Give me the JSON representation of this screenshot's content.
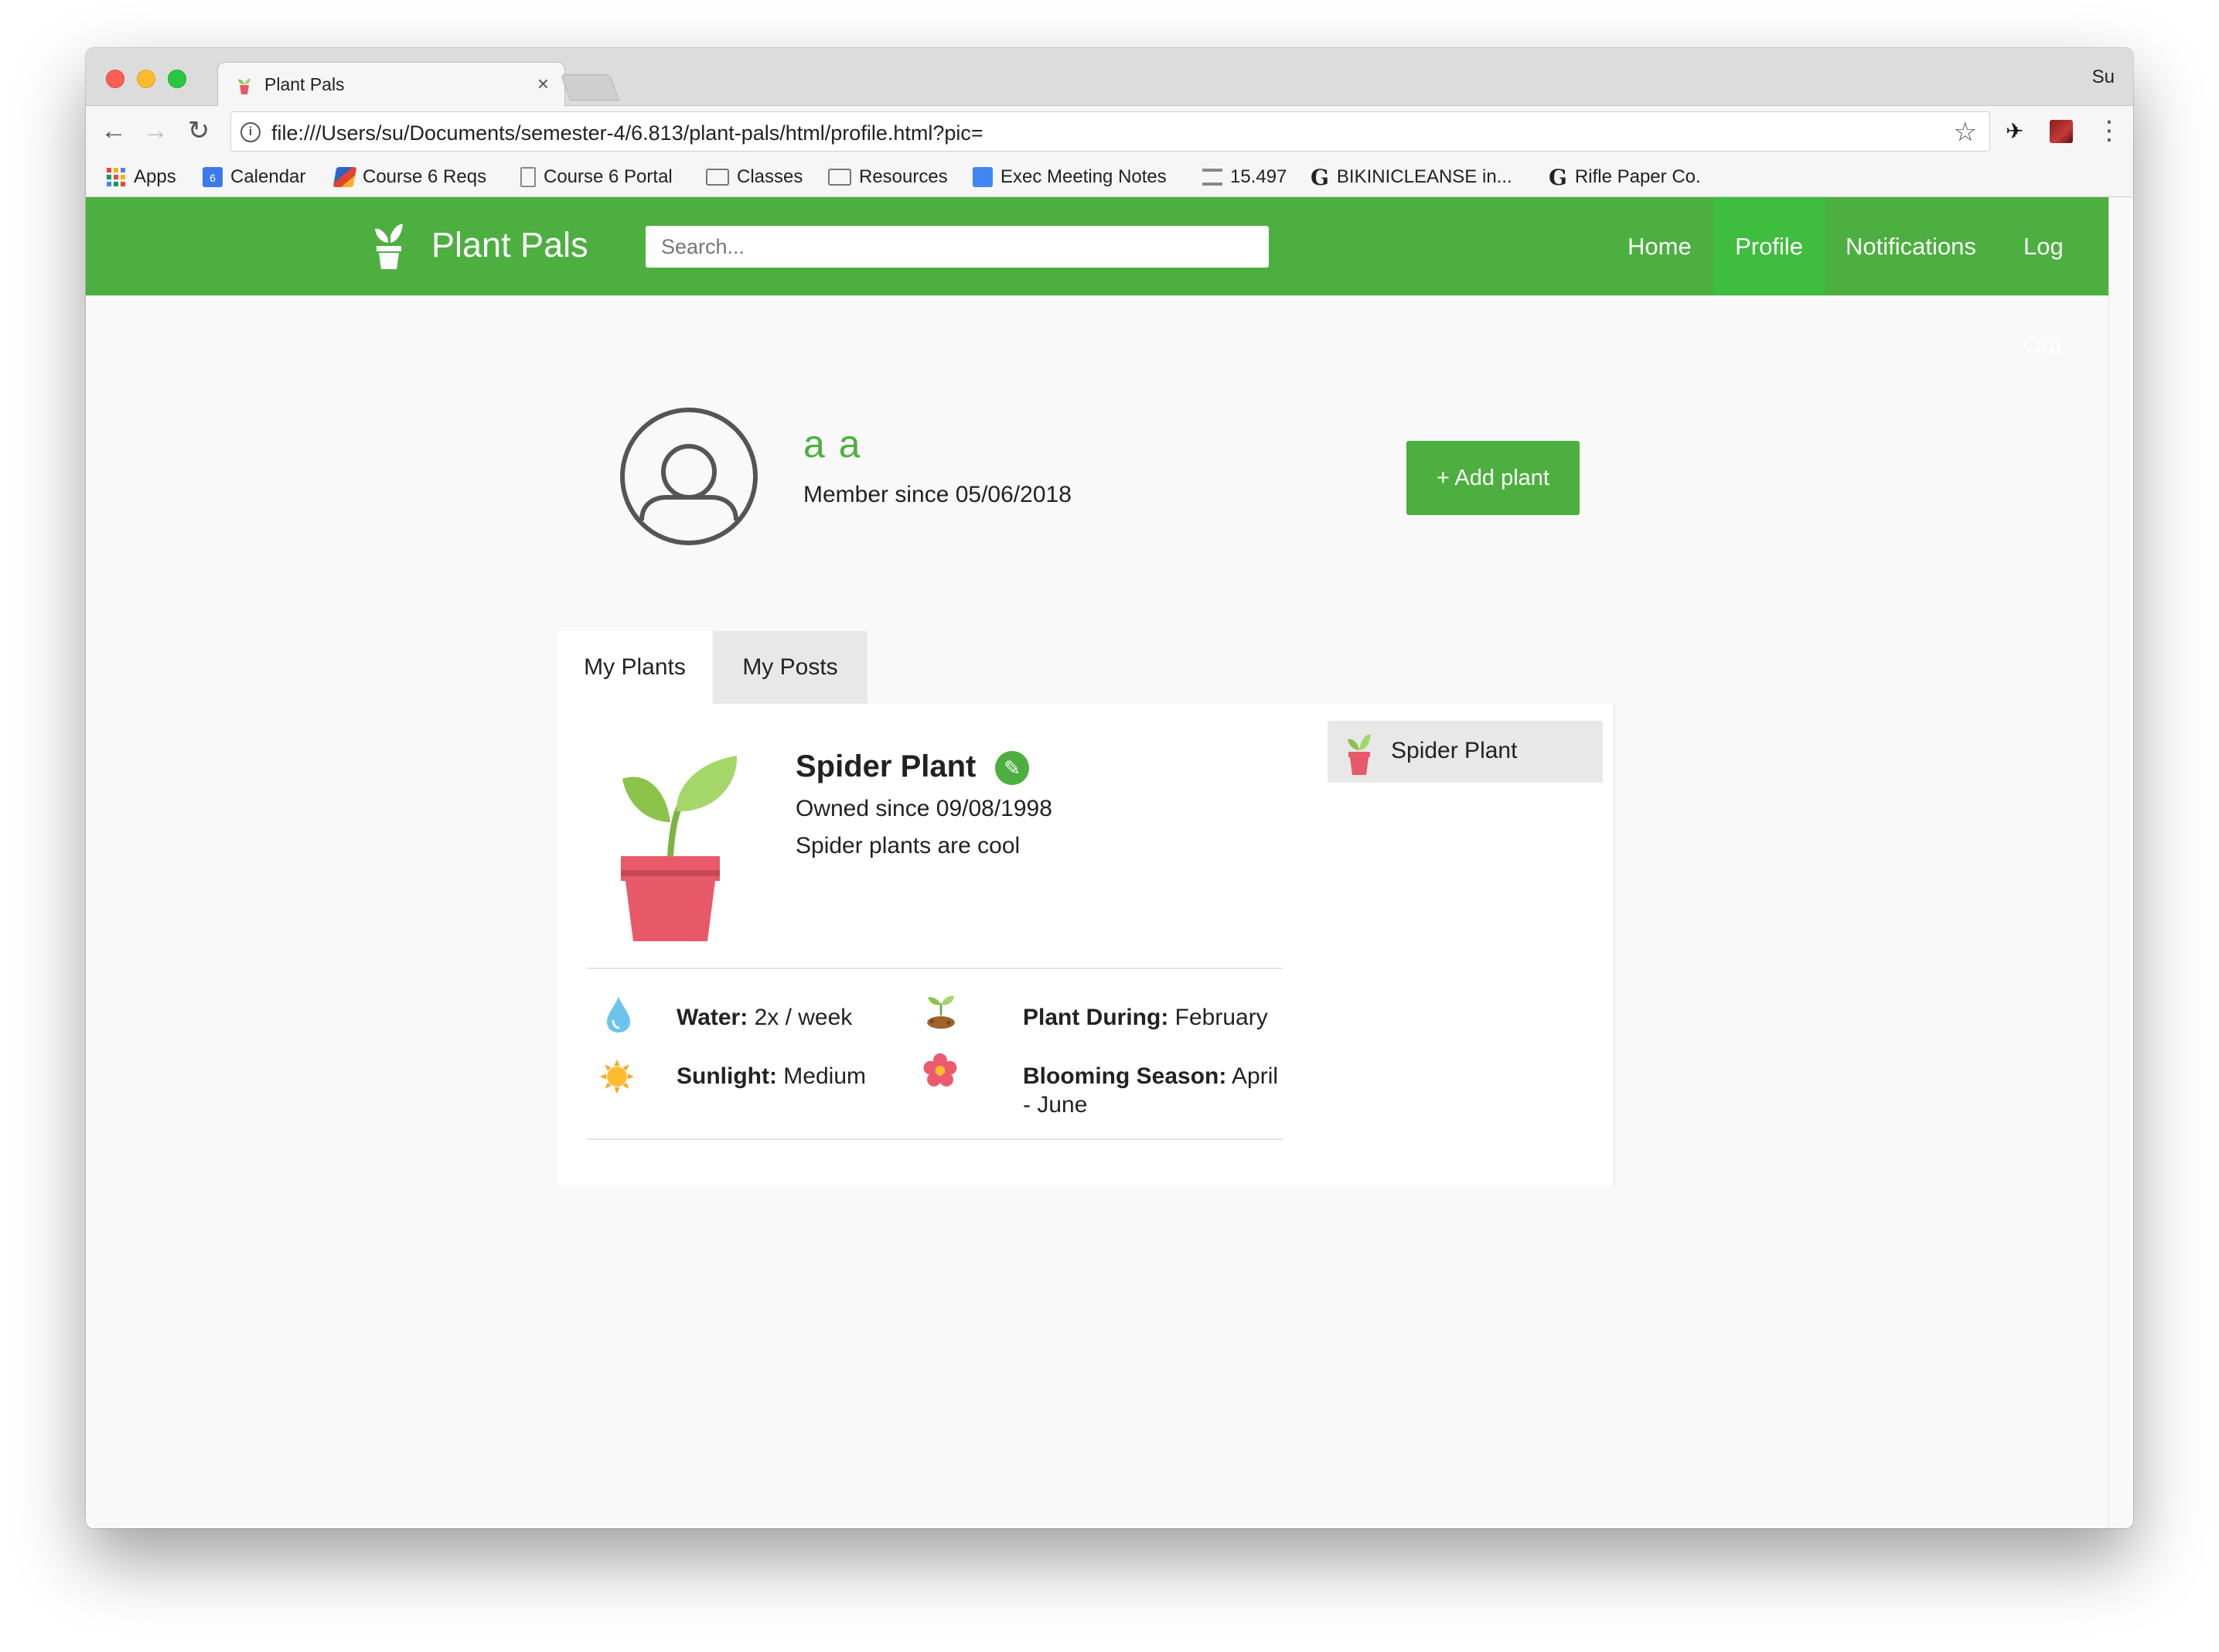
{
  "browser": {
    "tab_title": "Plant Pals",
    "tab_close": "×",
    "profile_name": "Su",
    "url": "file:///Users/su/Documents/semester-4/6.813/plant-pals/html/profile.html?pic=",
    "bookmarks": [
      {
        "label": "Apps",
        "icon": "apps-grid-icon"
      },
      {
        "label": "Calendar",
        "icon": "calendar-icon",
        "badge": "6"
      },
      {
        "label": "Course 6 Reqs",
        "icon": "course-icon"
      },
      {
        "label": "Course 6 Portal",
        "icon": "page-icon"
      },
      {
        "label": "Classes",
        "icon": "folder-icon"
      },
      {
        "label": "Resources",
        "icon": "folder-icon"
      },
      {
        "label": "Exec Meeting Notes",
        "icon": "gdoc-icon"
      },
      {
        "label": "15.497",
        "icon": "bank-icon"
      },
      {
        "label": "BIKINICLEANSE in...",
        "icon": "g-icon"
      },
      {
        "label": "Rifle Paper Co.",
        "icon": "g-icon"
      }
    ]
  },
  "app": {
    "brand": "Plant Pals",
    "search_placeholder": "Search...",
    "nav": {
      "home": "Home",
      "profile": "Profile",
      "notifications": "Notifications",
      "logout": "Log Out"
    },
    "accent": "#4caf3f",
    "active_nav": "#3fbd3e"
  },
  "profile": {
    "name": "a a",
    "member_since": "Member since 05/06/2018",
    "add_button": "+ Add plant"
  },
  "tabs": {
    "my_plants": "My Plants",
    "my_posts": "My Posts"
  },
  "plant": {
    "name": "Spider Plant",
    "owned_since": "Owned since 09/08/1998",
    "description": "Spider plants are cool",
    "water_label": "Water:",
    "water_value": " 2x / week",
    "sunlight_label": "Sunlight:",
    "sunlight_value": " Medium",
    "plant_during_label": "Plant During:",
    "plant_during_value": " February",
    "blooming_label": "Blooming Season:",
    "blooming_value_1": " April",
    "blooming_value_2": "- June"
  },
  "sidebar": {
    "items": [
      {
        "label": "Spider Plant"
      }
    ]
  }
}
